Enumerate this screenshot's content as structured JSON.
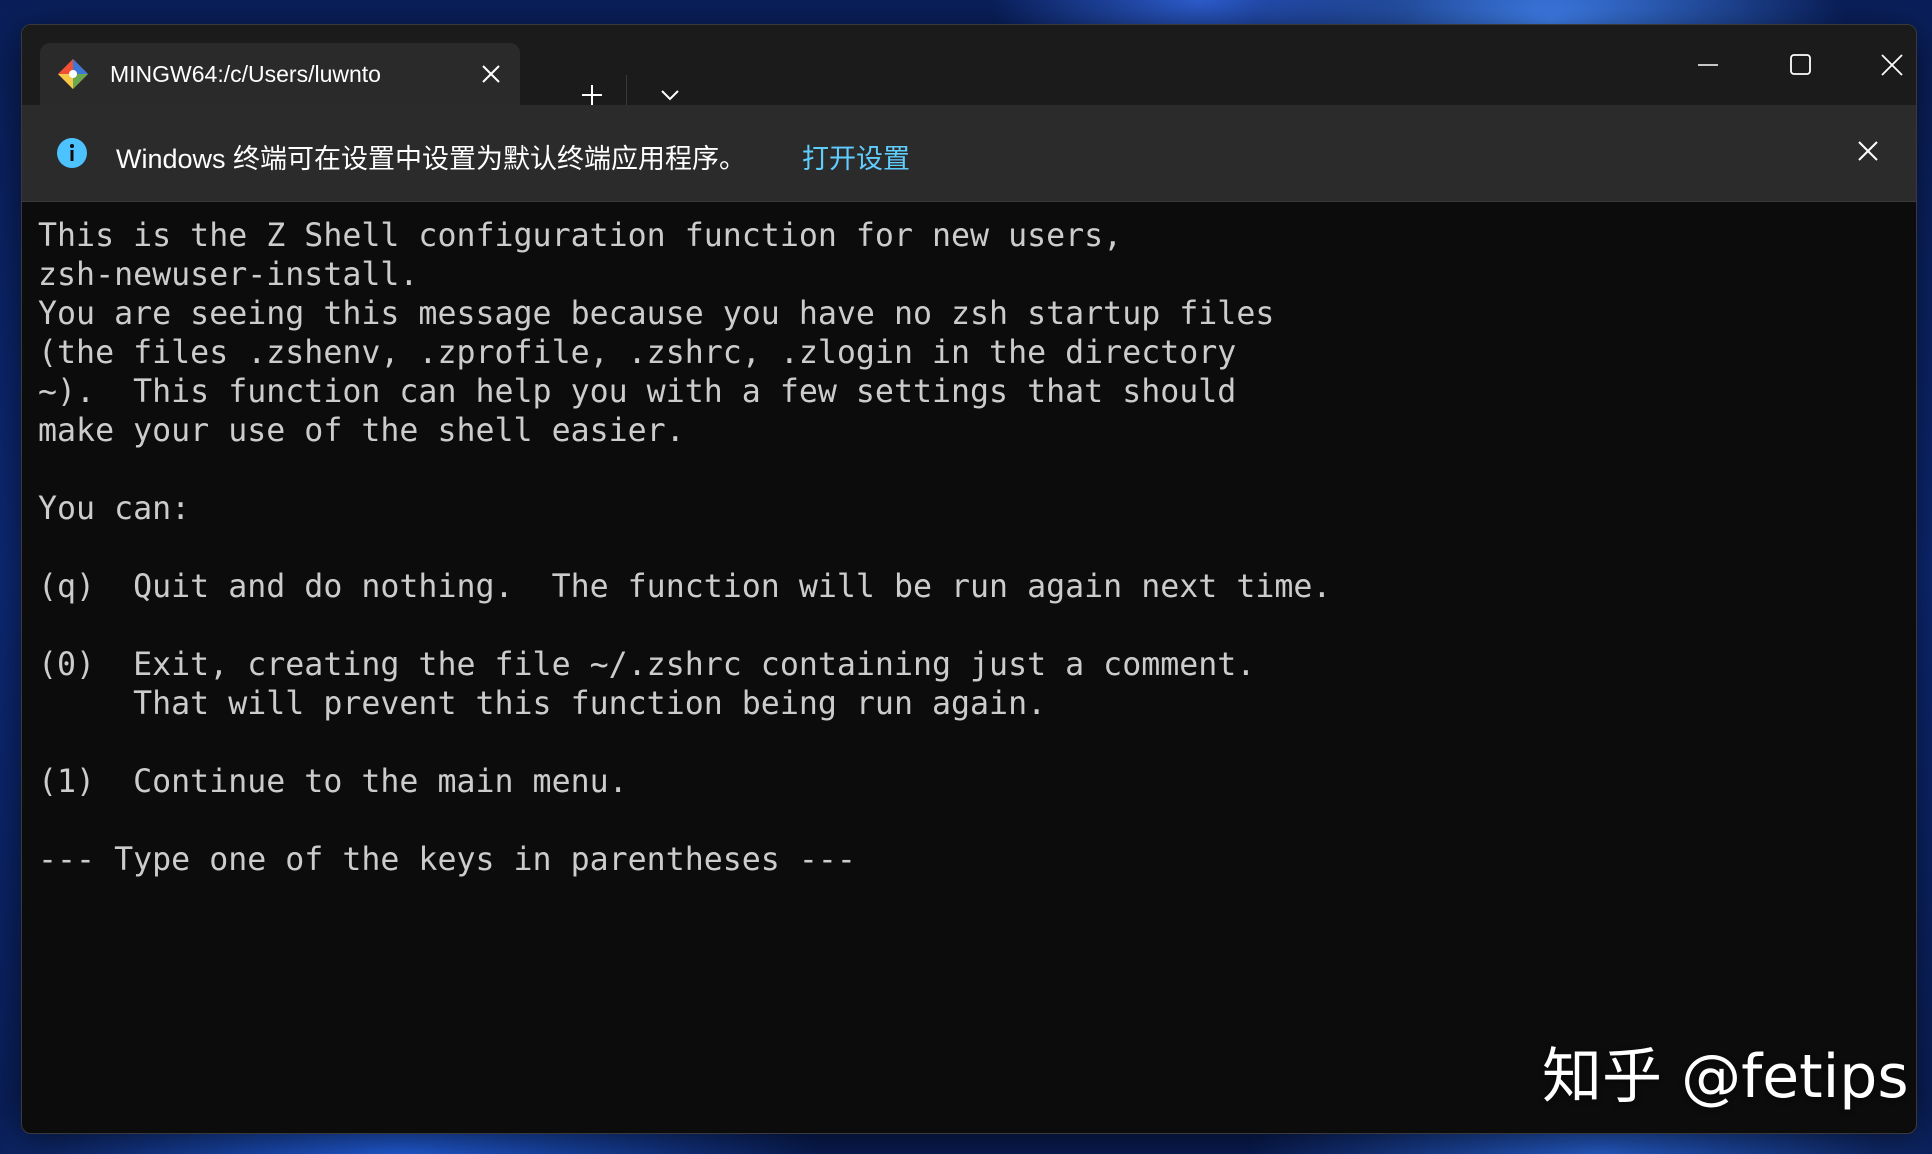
{
  "tab": {
    "title": "MINGW64:/c/Users/luwnto",
    "icon": "git-bash-icon"
  },
  "infobar": {
    "message": "Windows 终端可在设置中设置为默认终端应用程序。",
    "link": "打开设置"
  },
  "terminal": {
    "lines": [
      "This is the Z Shell configuration function for new users,",
      "zsh-newuser-install.",
      "You are seeing this message because you have no zsh startup files",
      "(the files .zshenv, .zprofile, .zshrc, .zlogin in the directory",
      "~).  This function can help you with a few settings that should",
      "make your use of the shell easier.",
      "",
      "You can:",
      "",
      "(q)  Quit and do nothing.  The function will be run again next time.",
      "",
      "(0)  Exit, creating the file ~/.zshrc containing just a comment.",
      "     That will prevent this function being run again.",
      "",
      "(1)  Continue to the main menu.",
      "",
      "--- Type one of the keys in parentheses ---"
    ]
  },
  "watermark": "知乎 @fetips",
  "colors": {
    "terminal_bg": "#0c0c0c",
    "terminal_fg": "#cccccc",
    "link": "#60cdff",
    "info_icon": "#4cc2ff"
  }
}
